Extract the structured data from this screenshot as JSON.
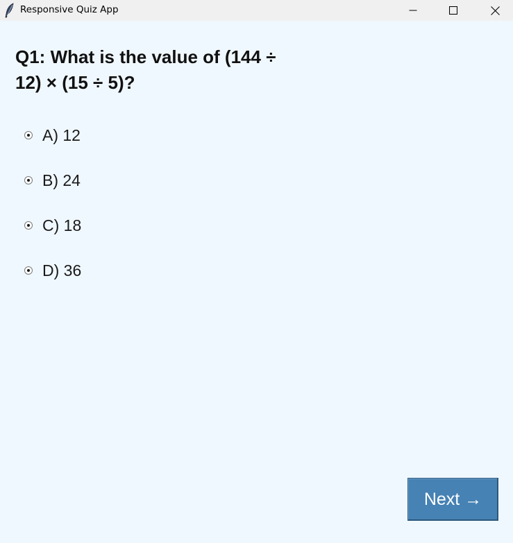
{
  "window": {
    "title": "Responsive Quiz App",
    "icon": "feather-icon",
    "controls": {
      "minimize_icon": "minimize-icon",
      "maximize_icon": "maximize-icon",
      "close_icon": "close-icon"
    }
  },
  "quiz": {
    "question": "Q1: What is the value of (144 ÷ 12) × (15 ÷ 5)?",
    "options": [
      {
        "label": "A) 12"
      },
      {
        "label": "B) 24"
      },
      {
        "label": "C) 18"
      },
      {
        "label": "D) 36"
      }
    ],
    "next_label": "Next →"
  },
  "colors": {
    "background": "#f0f8ff",
    "titlebar": "#f0f0f0",
    "next_button": "#4682b4",
    "next_text": "#ffffff"
  }
}
